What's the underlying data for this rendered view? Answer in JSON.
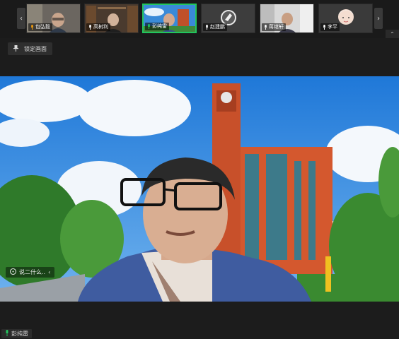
{
  "filmstrip": {
    "prev_arrow": "‹",
    "next_arrow": "›",
    "tiles": [
      {
        "name": "包弘毅",
        "active": false
      },
      {
        "name": "高树利",
        "active": false
      },
      {
        "name": "彭纯雷",
        "active": true
      },
      {
        "name": "赵建鹏",
        "active": false
      },
      {
        "name": "蒋继轩",
        "active": false
      },
      {
        "name": "李平",
        "active": false
      }
    ],
    "collapse_icon": "⌃"
  },
  "pin": {
    "label": "锁定画面"
  },
  "overlay": {
    "label": "说二什么.."
  },
  "speaker": {
    "name": "彭纯雷"
  },
  "colors": {
    "active_border": "#22c55e",
    "background": "#1c1c1c"
  }
}
